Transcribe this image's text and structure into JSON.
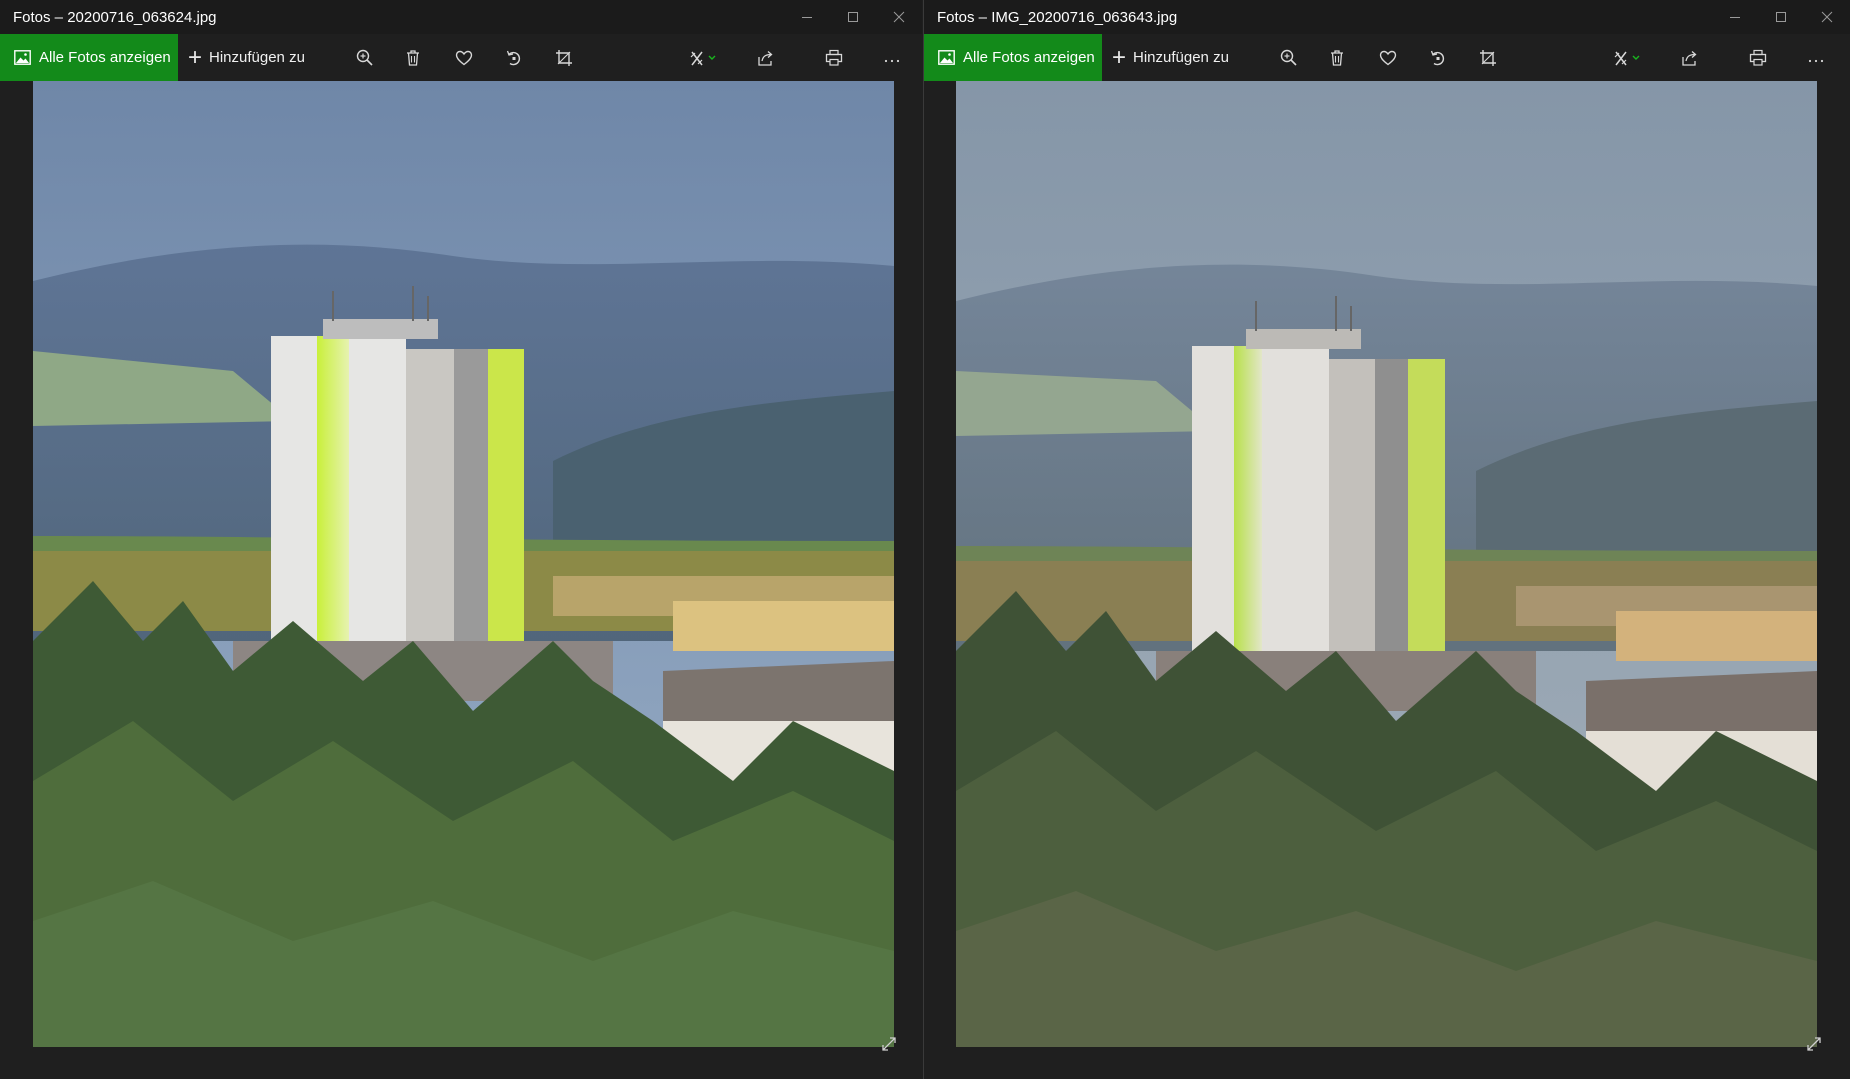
{
  "colors": {
    "accent_green": "#138a1a",
    "titlebar_bg": "#1b1b1b",
    "window_bg": "#1f1f1f",
    "toolbar_icon": "#d8d8d8"
  },
  "windows": [
    {
      "title": "Fotos – 20200716_063624.jpg",
      "toolbar": {
        "all_photos_label": "Alle Fotos anzeigen",
        "add_to_label": "Hinzufügen zu",
        "icons": [
          "zoom-icon",
          "delete-icon",
          "favorite-icon",
          "rotate-icon",
          "crop-icon",
          "edit-icon",
          "share-icon",
          "print-icon",
          "more-icon"
        ]
      }
    },
    {
      "title": "Fotos – IMG_20200716_063643.jpg",
      "toolbar": {
        "all_photos_label": "Alle Fotos anzeigen",
        "add_to_label": "Hinzufügen zu",
        "icons": [
          "zoom-icon",
          "delete-icon",
          "favorite-icon",
          "rotate-icon",
          "crop-icon",
          "edit-icon",
          "share-icon",
          "print-icon",
          "more-icon"
        ]
      }
    }
  ]
}
